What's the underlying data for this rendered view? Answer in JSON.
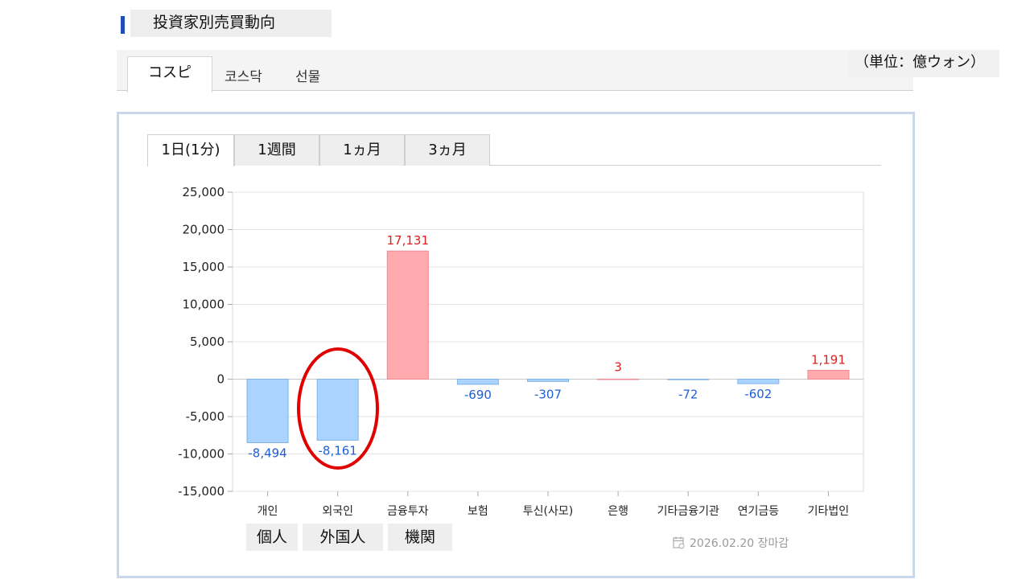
{
  "page": {
    "title": "投資家別売買動向",
    "unit": "（単位：億ウォン）",
    "market_tabs": [
      "コスピ",
      "코스닥",
      "선물"
    ],
    "period_tabs": [
      "1日(1分)",
      "1週間",
      "1ヵ月",
      "3ヵ月"
    ],
    "ja_labels": [
      "個人",
      "外国人",
      "機関"
    ],
    "footer_date": "2026.02.20 장마감",
    "footer_icon": "calendar-icon"
  },
  "chart_data": {
    "type": "bar",
    "categories": [
      "개인",
      "외국인",
      "금융투자",
      "보험",
      "투신(사모)",
      "은행",
      "기타금융기관",
      "연기금등",
      "기타법인"
    ],
    "values": [
      -8494,
      -8161,
      17131,
      -690,
      -307,
      3,
      -72,
      -602,
      1191
    ],
    "value_labels": [
      "-8,494",
      "-8,161",
      "17,131",
      "-690",
      "-307",
      "3",
      "-72",
      "-602",
      "1,191"
    ],
    "ylim": [
      -15000,
      25000
    ],
    "yticks": [
      "25,000",
      "20,000",
      "15,000",
      "10,000",
      "5,000",
      "0",
      "-5,000",
      "-10,000",
      "-15,000"
    ],
    "ytick_values": [
      25000,
      20000,
      15000,
      10000,
      5000,
      0,
      -5000,
      -10000,
      -15000
    ],
    "grid": true,
    "colors": {
      "positive_fill": "#ffaaaf",
      "positive_stroke": "#f08890",
      "positive_text": "#e01e1e",
      "negative_fill": "#aad3ff",
      "negative_stroke": "#7db3ea",
      "negative_text": "#1f5fd6"
    },
    "highlight": {
      "category": "외국인",
      "color": "#e00000"
    }
  }
}
